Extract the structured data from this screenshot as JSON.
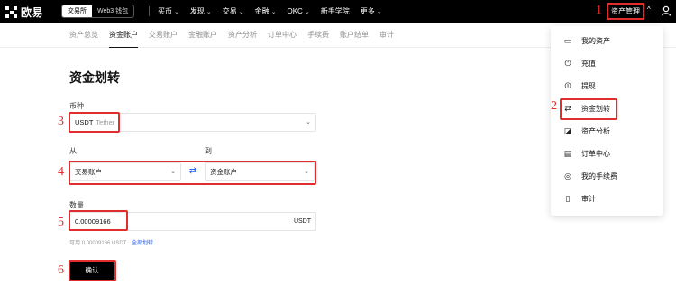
{
  "brand": {
    "name": "欧易"
  },
  "header": {
    "segment": [
      "交易所",
      "Web3 钱包"
    ],
    "nav": [
      {
        "label": "买币",
        "chevron": true
      },
      {
        "label": "发现",
        "chevron": true
      },
      {
        "label": "交易",
        "chevron": true
      },
      {
        "label": "金融",
        "chevron": true
      },
      {
        "label": "OKC",
        "chevron": true
      },
      {
        "label": "新手学院",
        "chevron": false
      },
      {
        "label": "更多",
        "chevron": true
      }
    ],
    "asset_button": "资产管理"
  },
  "subnav": {
    "tabs": [
      "资产总览",
      "资金账户",
      "交易账户",
      "金融账户",
      "资产分析",
      "订单中心",
      "手续费",
      "账户结单",
      "审计"
    ],
    "active": "资金账户"
  },
  "page_title": "资金划转",
  "form": {
    "currency_label": "币种",
    "currency_value": "USDT",
    "currency_name": "Tether",
    "from_label": "从",
    "from_value": "交易账户",
    "to_label": "到",
    "to_value": "资金账户",
    "amount_label": "数量",
    "amount_value": "0.00009166",
    "amount_unit": "USDT",
    "available_label": "可用",
    "available_value": "0.00009166 USDT",
    "transfer_all": "全部划转",
    "confirm": "确认"
  },
  "steps": [
    "1",
    "2",
    "3",
    "4",
    "5",
    "6"
  ],
  "dropdown": {
    "items": [
      {
        "label": "我的资产",
        "icon": "wallet-icon"
      },
      {
        "label": "充值",
        "icon": "deposit-icon"
      },
      {
        "label": "提现",
        "icon": "withdraw-icon"
      },
      {
        "label": "资金划转",
        "icon": "transfer-icon"
      },
      {
        "label": "资产分析",
        "icon": "analysis-icon"
      },
      {
        "label": "订单中心",
        "icon": "order-icon"
      },
      {
        "label": "我的手续费",
        "icon": "fee-icon"
      },
      {
        "label": "审计",
        "icon": "audit-icon"
      }
    ]
  },
  "colors": {
    "highlight": "#e12d2d",
    "accent": "#1a5bf0"
  }
}
